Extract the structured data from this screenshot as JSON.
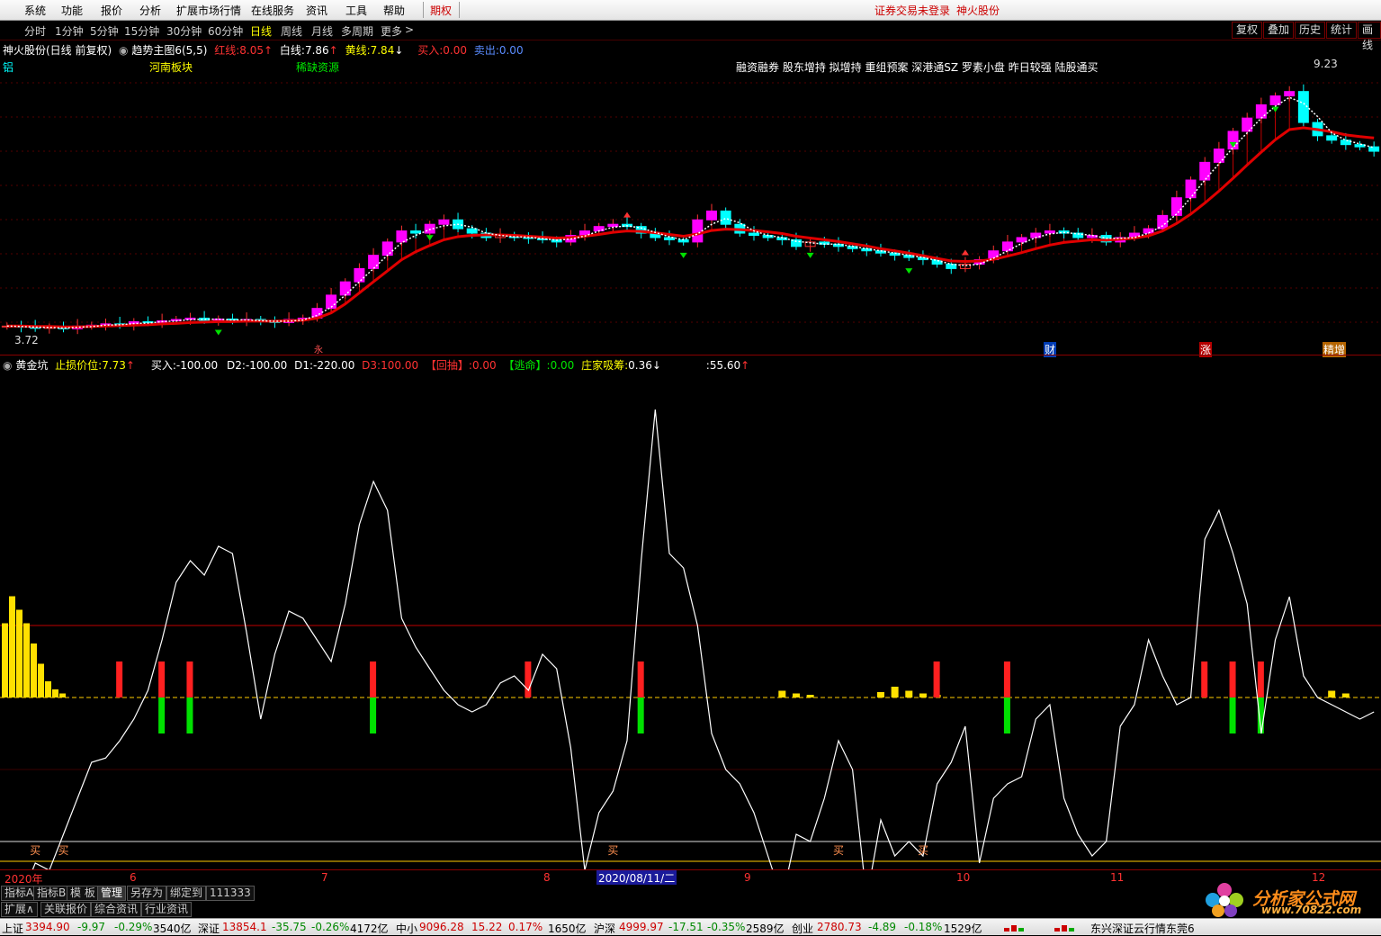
{
  "menu": {
    "items": [
      "系统",
      "功能",
      "报价",
      "分析",
      "扩展市场行情",
      "在线服务",
      "资讯",
      "工具",
      "帮助",
      "期权"
    ],
    "right_status": "证券交易未登录",
    "right_stock": "神火股份"
  },
  "toolbar": {
    "periods": [
      "分时",
      "1分钟",
      "5分钟",
      "15分钟",
      "30分钟",
      "60分钟",
      "日线",
      "周线",
      "月线",
      "多周期",
      "更多"
    ],
    "selected": "日线",
    "more_chevron": ">",
    "right_buttons": [
      "复权",
      "叠加",
      "历史",
      "统计",
      "画线"
    ]
  },
  "main_chart": {
    "stock_title": "神火股份(日线 前复权)",
    "indicator_name": "趋势主图6(5,5)",
    "red_line_label": "红线:",
    "red_line_value": "8.05",
    "white_line_label": "白线:",
    "white_line_value": "7.86",
    "yellow_line_label": "黄线:",
    "yellow_line_value": "7.84",
    "buy_label": "买入:",
    "buy_value": "0.00",
    "sell_label": "卖出:",
    "sell_value": "0.00",
    "up_arrow": "↑",
    "down_arrow": "↓",
    "tags_left": [
      "铝",
      "河南板块",
      "稀缺资源"
    ],
    "tags_right": "融资融券 股东增持 拟增持 重组预案 深港通SZ 罗素小盘 昨日较强 陆股通买",
    "high_label": "9.23",
    "low_label": "3.72",
    "event_marks": [
      "财",
      "涨",
      "精增"
    ],
    "event_mark_small": "永"
  },
  "sub_chart": {
    "indicator_name": "黄金坑",
    "stop_label": "止损价位:",
    "stop_value": "7.73",
    "buy_label": "买入:",
    "buy_value": "-100.00",
    "d2_label": "D2:",
    "d2_value": "-100.00",
    "d1_label": "D1:",
    "d1_value": "-220.00",
    "d3_label": "D3:",
    "d3_value": "100.00",
    "huichou_label": "【回抽】:",
    "huichou_value": "0.00",
    "taoming_label": "【逃命】:",
    "taoming_value": "0.00",
    "zhuangjia_label": "庄家吸筹:",
    "zhuangjia_value": "0.36",
    "last_label": ":",
    "last_value": "55.60",
    "buy_mark": "买"
  },
  "time_axis": {
    "labels": [
      "2020年",
      "6",
      "7",
      "8",
      "9",
      "10",
      "11",
      "12"
    ],
    "cursor_date": "2020/08/11/二"
  },
  "bottom_tabs": {
    "row1": [
      "指标A",
      "指标B",
      "模 板",
      "管理",
      "另存为",
      "绑定到",
      "111333"
    ],
    "row2": [
      "扩展∧",
      "关联报价",
      "综合资讯",
      "行业资讯"
    ]
  },
  "status": {
    "indices": [
      {
        "name": "上证",
        "value": "3394.90",
        "change": "-9.97",
        "pct": "-0.29%",
        "amount": "3540亿"
      },
      {
        "name": "深证",
        "value": "13854.1",
        "change": "-35.75",
        "pct": "-0.26%",
        "amount": "4172亿"
      },
      {
        "name": "中小",
        "value": "9096.28",
        "change": "15.22",
        "pct": "0.17%",
        "amount": "1650亿"
      },
      {
        "name": "沪深",
        "value": "4999.97",
        "change": "-17.51",
        "pct": "-0.35%",
        "amount": "2589亿"
      },
      {
        "name": "创业",
        "value": "2780.73",
        "change": "-4.89",
        "pct": "-0.18%",
        "amount": "1529亿"
      }
    ],
    "server": "东兴深证云行情东莞6"
  },
  "watermark": {
    "text": "分析家公式网",
    "url": "www.70822.com"
  },
  "colors": {
    "up": "#ff3232",
    "down": "#00ffff",
    "trend": "#e00000",
    "accent": "#ff00ff",
    "yellow": "#ffe000",
    "green": "#00e000"
  },
  "chart_data": [
    {
      "type": "candlestick",
      "title": "",
      "series": [
        {
          "name": "收盘价",
          "values": [
            3.8,
            3.78,
            3.75,
            3.78,
            3.74,
            3.8,
            3.82,
            3.85,
            3.82,
            3.9,
            3.88,
            3.92,
            3.95,
            3.98,
            3.93,
            3.96,
            3.92,
            3.95,
            3.9,
            3.88,
            3.95,
            3.98,
            4.2,
            4.5,
            4.8,
            5.1,
            5.4,
            5.7,
            5.95,
            5.9,
            6.1,
            6.2,
            6.0,
            5.9,
            5.8,
            5.85,
            5.8,
            5.78,
            5.75,
            5.7,
            5.85,
            5.95,
            6.05,
            6.1,
            6.05,
            5.9,
            5.8,
            5.75,
            5.7,
            6.2,
            6.4,
            6.1,
            5.9,
            5.85,
            5.8,
            5.75,
            5.6,
            5.7,
            5.65,
            5.6,
            5.55,
            5.5,
            5.45,
            5.4,
            5.35,
            5.3,
            5.2,
            5.1,
            5.2,
            5.3,
            5.5,
            5.7,
            5.8,
            5.9,
            5.95,
            5.9,
            5.8,
            5.85,
            5.7,
            5.8,
            5.9,
            6.0,
            6.3,
            6.7,
            7.1,
            7.5,
            7.8,
            8.2,
            8.5,
            8.8,
            9.0,
            9.1,
            8.4,
            8.1,
            8.0,
            7.9,
            7.85,
            7.75
          ],
          "low_mark": 3.72,
          "high_mark": 9.23
        },
        {
          "name": "红线",
          "values": [
            3.8,
            3.8,
            3.79,
            3.79,
            3.78,
            3.78,
            3.79,
            3.8,
            3.81,
            3.82,
            3.83,
            3.85,
            3.86,
            3.88,
            3.89,
            3.9,
            3.9,
            3.91,
            3.91,
            3.91,
            3.92,
            3.93,
            3.98,
            4.1,
            4.3,
            4.55,
            4.8,
            5.05,
            5.3,
            5.48,
            5.62,
            5.75,
            5.82,
            5.85,
            5.86,
            5.86,
            5.85,
            5.83,
            5.81,
            5.79,
            5.8,
            5.83,
            5.87,
            5.92,
            5.95,
            5.94,
            5.91,
            5.87,
            5.83,
            5.88,
            5.96,
            5.99,
            5.98,
            5.96,
            5.93,
            5.89,
            5.83,
            5.79,
            5.75,
            5.71,
            5.66,
            5.61,
            5.55,
            5.5,
            5.45,
            5.39,
            5.33,
            5.27,
            5.26,
            5.27,
            5.31,
            5.38,
            5.46,
            5.55,
            5.63,
            5.69,
            5.72,
            5.75,
            5.74,
            5.76,
            5.79,
            5.84,
            5.95,
            6.12,
            6.33,
            6.58,
            6.85,
            7.14,
            7.44,
            7.73,
            8.01,
            8.24,
            8.28,
            8.24,
            8.19,
            8.12,
            8.08,
            8.05
          ]
        }
      ]
    },
    {
      "type": "line",
      "title": "",
      "series": [
        {
          "name": "黄金坑",
          "values": [
            -160,
            -140,
            -115,
            -120,
            -95,
            -70,
            -45,
            -42,
            -30,
            -15,
            5,
            40,
            80,
            95,
            85,
            105,
            100,
            45,
            -15,
            30,
            60,
            55,
            40,
            25,
            65,
            120,
            150,
            130,
            55,
            35,
            20,
            5,
            -5,
            -10,
            -5,
            10,
            15,
            5,
            30,
            20,
            -35,
            -120,
            -80,
            -65,
            -30,
            95,
            200,
            100,
            90,
            50,
            -25,
            -50,
            -60,
            -80,
            -110,
            -140,
            -95,
            -100,
            -70,
            -30,
            -50,
            -140,
            -85,
            -110,
            -100,
            -110,
            -60,
            -45,
            -20,
            -115,
            -70,
            -60,
            -55,
            -15,
            -5,
            -70,
            -95,
            -110,
            -100,
            -20,
            -5,
            40,
            15,
            -5,
            0,
            110,
            130,
            100,
            65,
            -25,
            40,
            70,
            15,
            0,
            -5,
            -10,
            -15,
            -10
          ],
          "bars_yellow": [
            55,
            75,
            65,
            55,
            40,
            25,
            12,
            6,
            3
          ],
          "red_marks": [
            0,
            1,
            1,
            1,
            1,
            1,
            1,
            1,
            1,
            1
          ],
          "buy_marks": [
            "买",
            "买",
            "买",
            "买",
            "买"
          ]
        }
      ],
      "reference_lines": [
        0,
        50,
        -50,
        -100
      ]
    }
  ]
}
